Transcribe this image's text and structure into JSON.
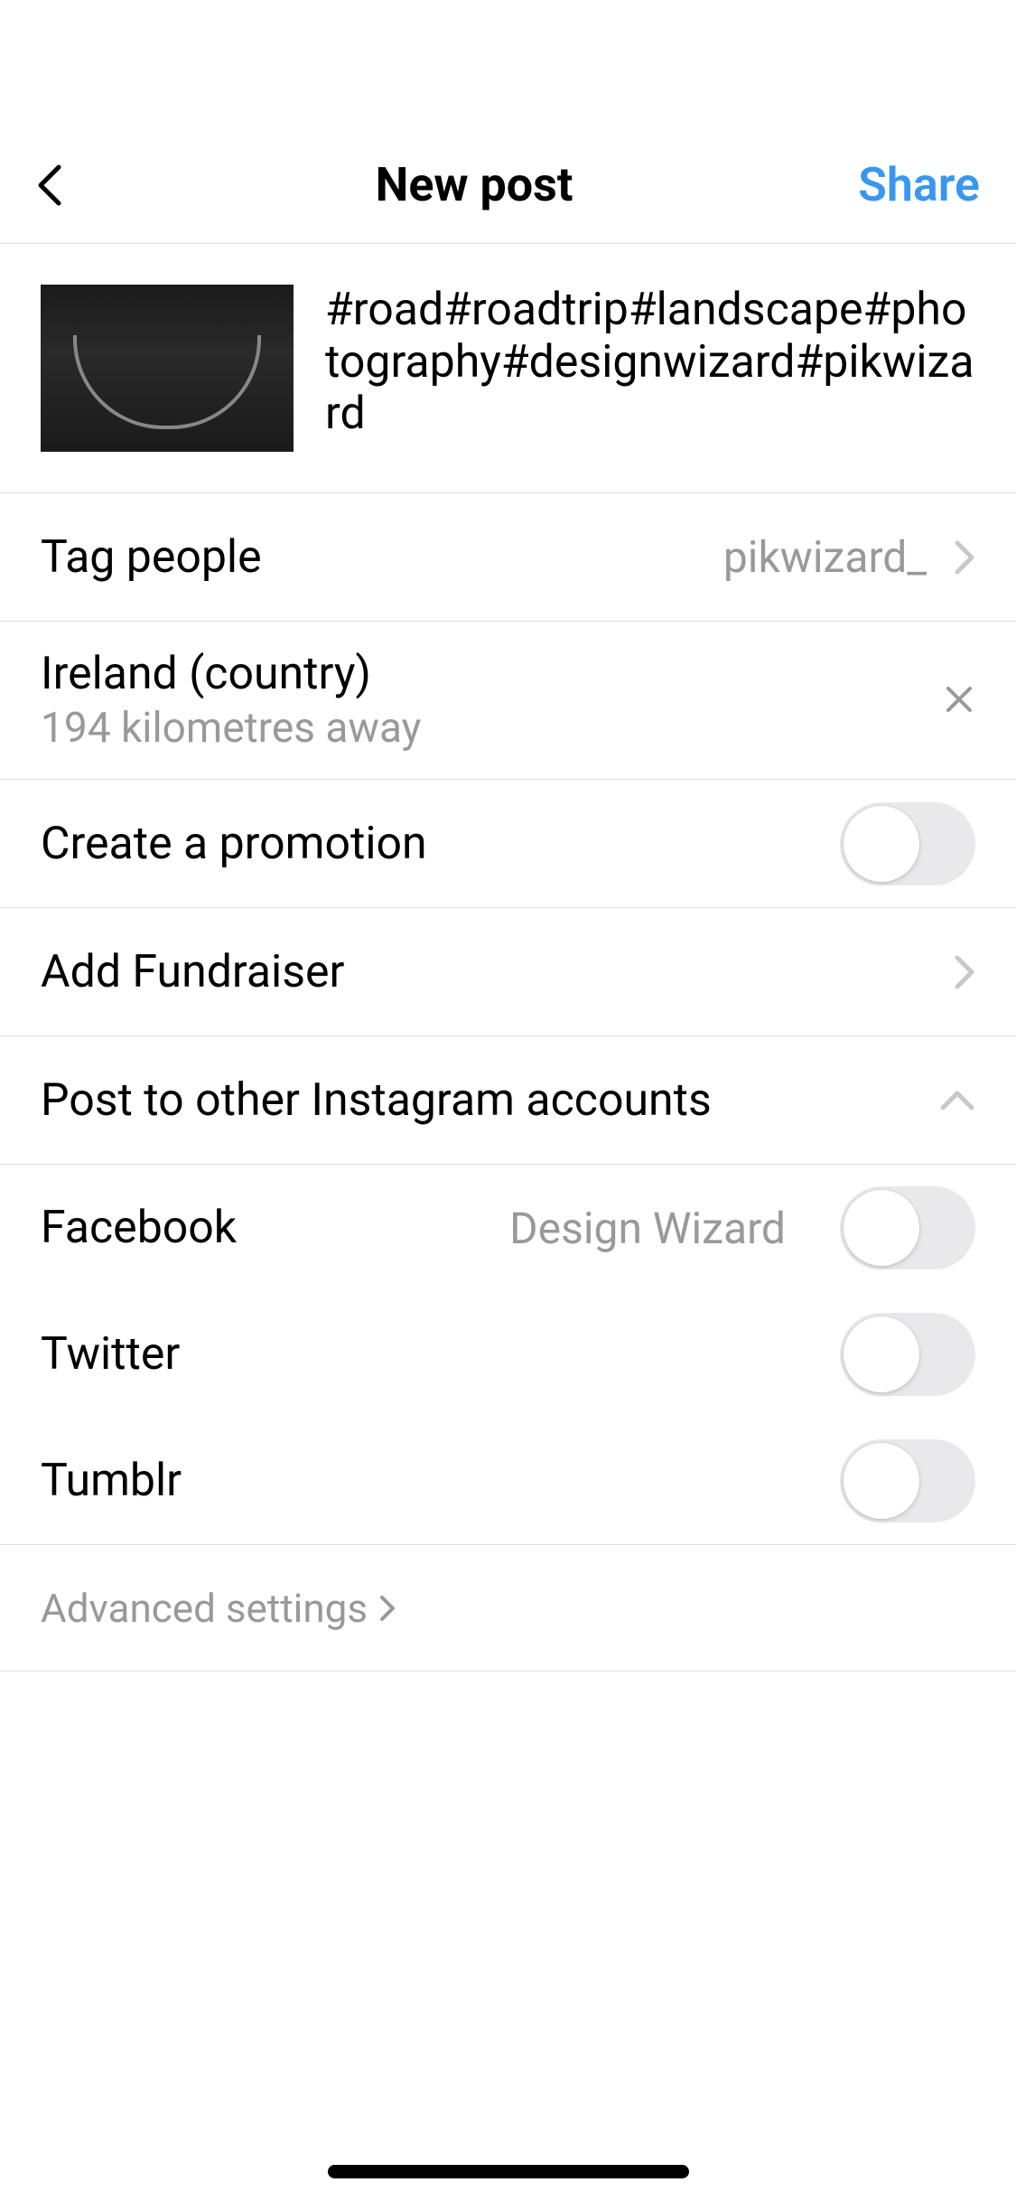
{
  "header": {
    "title": "New post",
    "share_label": "Share"
  },
  "caption": "#road#roadtrip#landscape#photography#designwizard#pikwizard",
  "tag_people": {
    "label": "Tag people",
    "value": "pikwizard_"
  },
  "location": {
    "name": "Ireland (country)",
    "distance": "194 kilometres away"
  },
  "promotion": {
    "label": "Create a promotion"
  },
  "fundraiser": {
    "label": "Add Fundraiser"
  },
  "other_accounts": {
    "label": "Post to other Instagram accounts"
  },
  "share_options": {
    "facebook": {
      "label": "Facebook",
      "account": "Design Wizard"
    },
    "twitter": {
      "label": "Twitter"
    },
    "tumblr": {
      "label": "Tumblr"
    }
  },
  "advanced": {
    "label": "Advanced settings"
  }
}
